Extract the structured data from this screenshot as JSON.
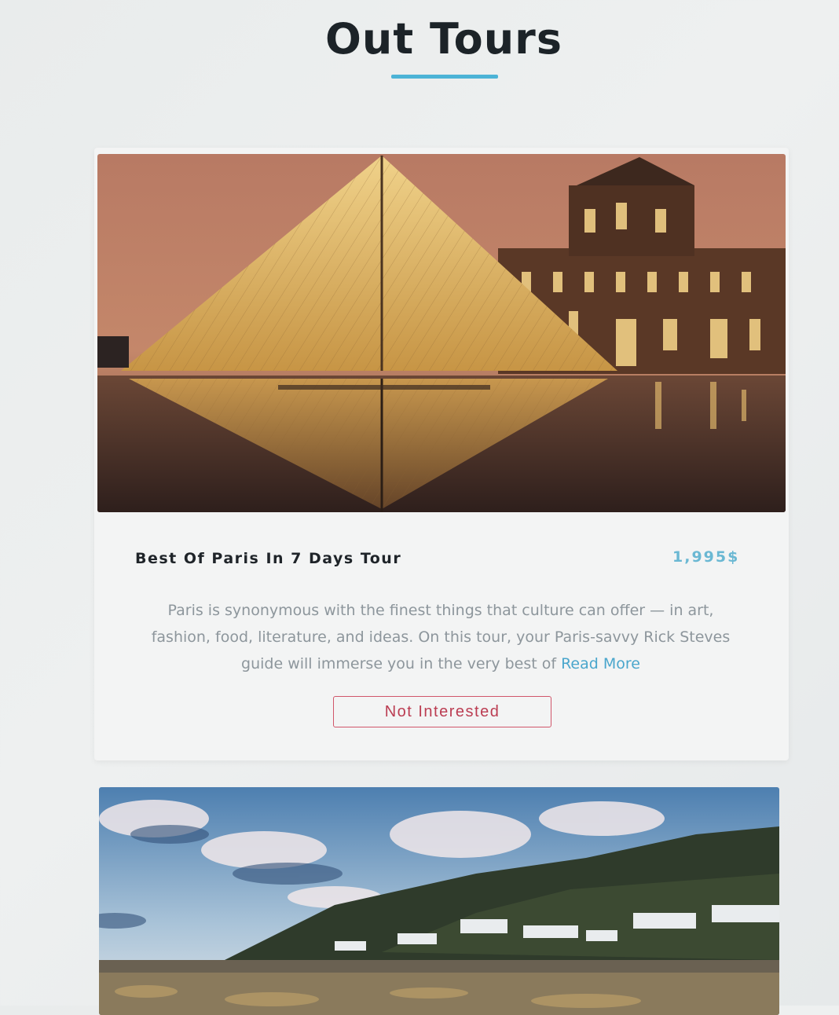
{
  "header": {
    "title": "Out Tours"
  },
  "tours": [
    {
      "image_icon": "louvre-pyramid-photo",
      "title": "Best Of Paris In 7 Days Tour",
      "price": "1,995$",
      "description": "Paris is synonymous with the finest things that culture can offer — in art, fashion, food, literature, and ideas. On this tour, your Paris-savvy Rick Steves guide will immerse you in the very best of",
      "read_more_label": "Read More",
      "dismiss_label": "Not Interested"
    },
    {
      "image_icon": "coastal-town-photo"
    }
  ],
  "colors": {
    "accent": "#4cb3d6",
    "price": "#6ab8d3",
    "link": "#4aa6cc",
    "dismiss": "#d1566a",
    "title_text": "#1c2328"
  }
}
